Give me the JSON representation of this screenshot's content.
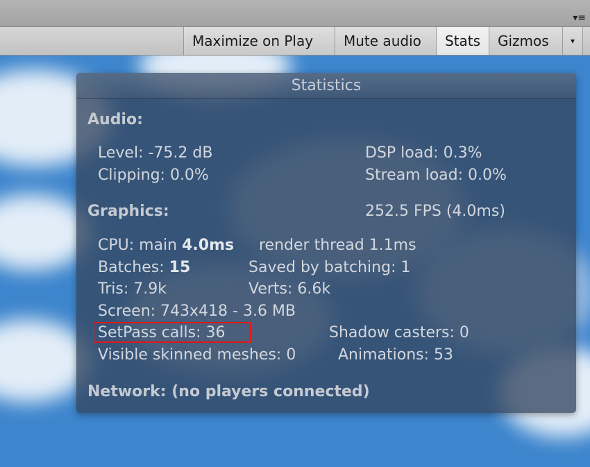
{
  "toolbar": {
    "buttons": [
      "Maximize on Play",
      "Mute audio",
      "Stats",
      "Gizmos"
    ],
    "active": "Stats",
    "dropdown_glyph": "▾",
    "panel_menu_glyph": "▾≡"
  },
  "stats": {
    "title": "Statistics",
    "audio": {
      "heading": "Audio:",
      "level": "Level: -75.2 dB",
      "clipping": "Clipping: 0.0%",
      "dsp_load": "DSP load: 0.3%",
      "stream_load": "Stream load: 0.0%"
    },
    "graphics": {
      "heading": "Graphics:",
      "fps": "252.5 FPS (4.0ms)",
      "cpu_prefix": "CPU: main ",
      "cpu_main": "4.0ms",
      "render_thread": "render thread 1.1ms",
      "batches_prefix": "Batches: ",
      "batches_value": "15",
      "saved_by_batching": "Saved by batching: 1",
      "tris": "Tris: 7.9k",
      "verts": "Verts: 6.6k",
      "screen": "Screen: 743x418 - 3.6 MB",
      "setpass": "SetPass calls: 36",
      "shadow_casters": "Shadow casters: 0",
      "visible_skinned": "Visible skinned meshes: 0",
      "animations": "Animations: 53"
    },
    "network": "Network: (no players connected)"
  },
  "colors": {
    "sky": "#3d85cd",
    "panel": "#344660",
    "highlight_border": "#e01818"
  }
}
